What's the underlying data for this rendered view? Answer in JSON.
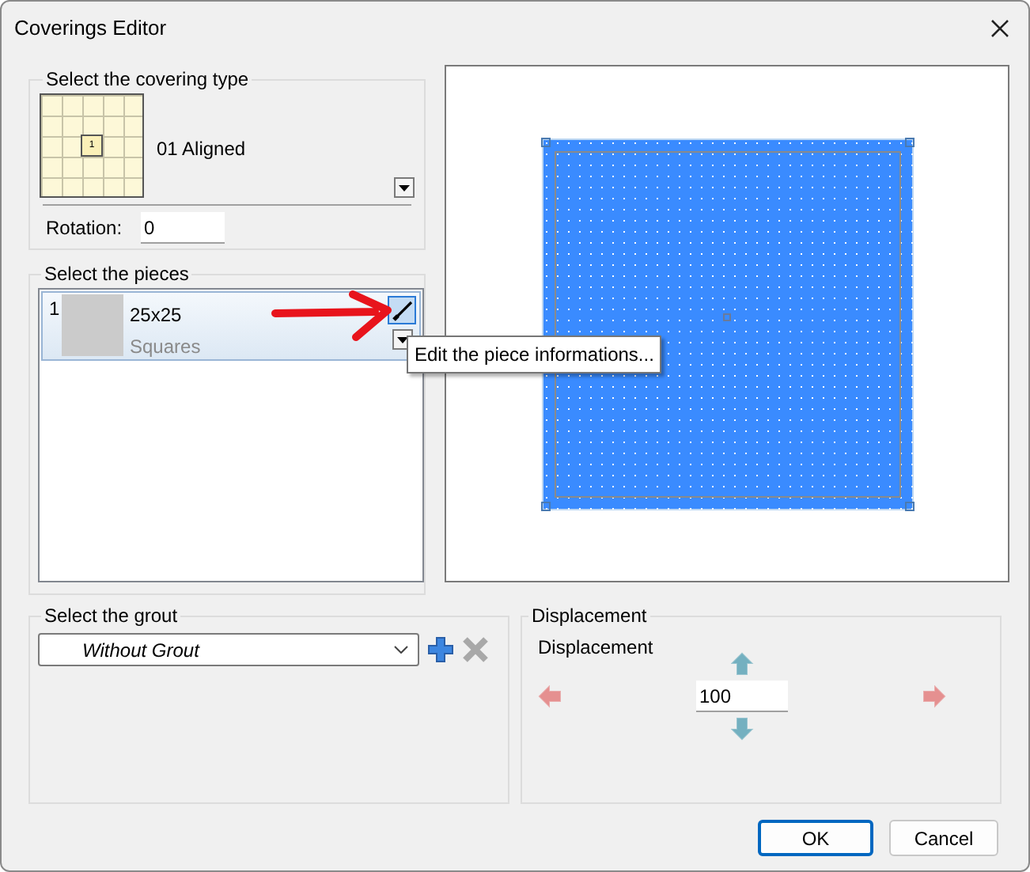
{
  "window": {
    "title": "Coverings Editor"
  },
  "covering_type": {
    "group_label": "Select the covering type",
    "tile_label": "1",
    "name": "01 Aligned",
    "rotation_label": "Rotation:",
    "rotation_value": "0"
  },
  "pieces": {
    "group_label": "Select the pieces",
    "tooltip": "Edit the piece informations...",
    "items": [
      {
        "index": "1",
        "size": "25x25",
        "shape": "Squares",
        "selected": true
      }
    ]
  },
  "grout": {
    "group_label": "Select the grout",
    "value": "Without Grout"
  },
  "displacement": {
    "group_label": "Displacement",
    "label": "Displacement",
    "value": "100"
  },
  "buttons": [
    {
      "label": "OK",
      "default": true
    },
    {
      "label": "Cancel",
      "default": false
    }
  ]
}
